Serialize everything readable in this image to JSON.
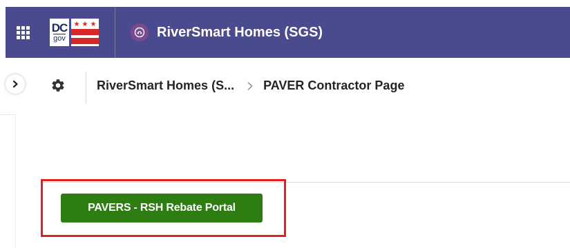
{
  "header": {
    "app_title": "RiverSmart Homes (SGS)",
    "logo": {
      "text_primary": "DC",
      "text_secondary": "gov"
    },
    "background_color": "#4a4a8e",
    "icons": {
      "app_launcher": "waffle-grid-icon",
      "app": "app-module-icon"
    }
  },
  "nav": {
    "breadcrumb": [
      {
        "label": "RiverSmart Homes (S..."
      },
      {
        "label": "PAVER Contractor Page"
      }
    ],
    "icons": {
      "expand": "chevron-right-icon",
      "settings": "gear-icon",
      "separator": "chevron-right-icon"
    }
  },
  "content": {
    "portal_button_label": "PAVERS - RSH Rebate Portal",
    "portal_button_color": "#2e7d12",
    "highlight_color": "#e02020"
  }
}
